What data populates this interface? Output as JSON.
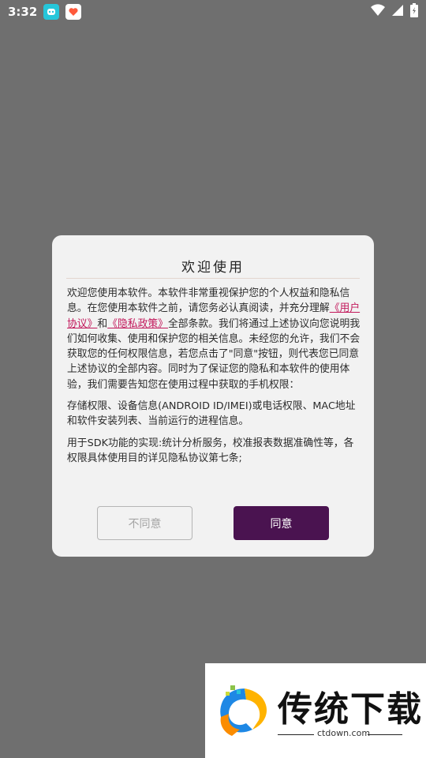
{
  "status_bar": {
    "time": "3:32"
  },
  "dialog": {
    "title": "欢迎使用",
    "para1_before": "欢迎您使用本软件。本软件非常重视保护您的个人权益和隐私信息。在您使用本软件之前，请您务必认真阅读，并充分理解",
    "user_agreement_link": "《用户协议》",
    "and_text": "和",
    "privacy_policy_link": "《隐私政策》",
    "para1_after": "全部条款。我们将通过上述协议向您说明我们如何收集、使用和保护您的相关信息。未经您的允许，我们不会获取您的任何权限信息，若您点击了\"同意\"按钮，则代表您已同意上述协议的全部内容。同时为了保证您的隐私和本软件的使用体验，我们需要告知您在使用过程中获取的手机权限：",
    "para2": "存储权限、设备信息(ANDROID ID/IMEI)或电话权限、MAC地址和软件安装列表、当前运行的进程信息。",
    "para3": "用于SDK功能的实现:统计分析服务，校准报表数据准确性等，各权限具体使用目的详见隐私协议第七条;",
    "reject_label": "不同意",
    "agree_label": "同意"
  },
  "watermark": {
    "title": "传统下载",
    "subtitle": "ctdown.com"
  },
  "colors": {
    "overlay": "#6f6f6f",
    "link": "#c2185b",
    "agree_button": "#4a1350"
  }
}
